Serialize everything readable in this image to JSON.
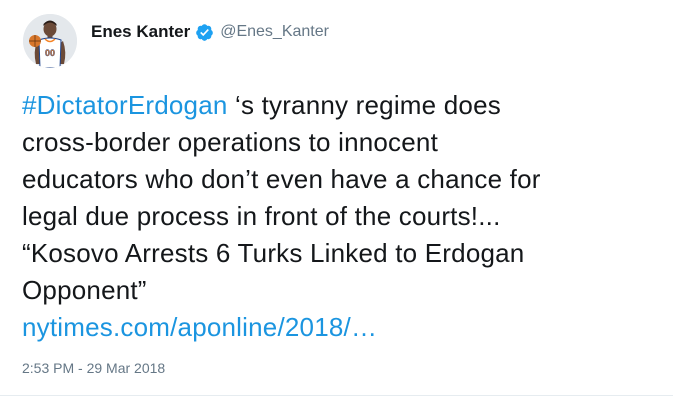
{
  "author": {
    "display_name": "Enes Kanter",
    "handle": "@Enes_Kanter",
    "verified_icon": "verified-badge-icon",
    "avatar_icon": "basketball-player-avatar",
    "verified_color": "#1da1f2"
  },
  "tweet": {
    "hashtag": "#DictatorErdogan",
    "lines": [
      " ‘s tyranny regime does",
      "cross-border operations to innocent",
      "educators who don’t even have a chance for",
      "legal due process in front of the courts!...",
      "“Kosovo Arrests 6 Turks Linked to Erdogan",
      "Opponent”"
    ],
    "link_text": "nytimes.com/aponline/2018/…",
    "link_color": "#1b95e0"
  },
  "timestamp": "2:53 PM - 29 Mar 2018"
}
